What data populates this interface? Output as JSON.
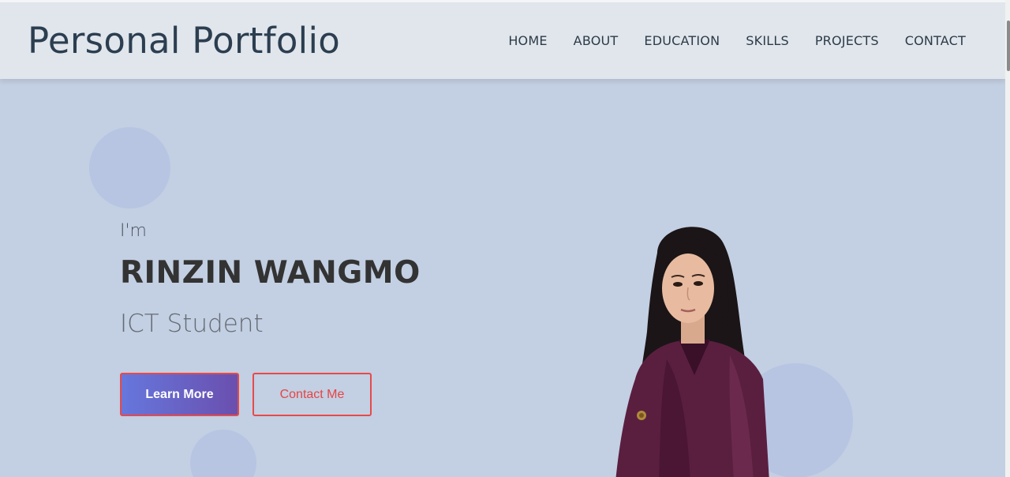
{
  "header": {
    "brand": "Personal Portfolio",
    "nav": [
      "HOME",
      "ABOUT",
      "EDUCATION",
      "SKILLS",
      "PROJECTS",
      "CONTACT"
    ]
  },
  "hero": {
    "intro": "I'm",
    "name": "RINZIN WANGMO",
    "role": "ICT Student",
    "primary_button": "Learn More",
    "secondary_button": "Contact Me"
  },
  "colors": {
    "background": "#c3cfe2",
    "header": "#e0e6ec",
    "brand_text": "#2c3e50",
    "accent_red": "#e64a4a",
    "gradient_start": "#6677dd",
    "gradient_end": "#6a4fae"
  }
}
